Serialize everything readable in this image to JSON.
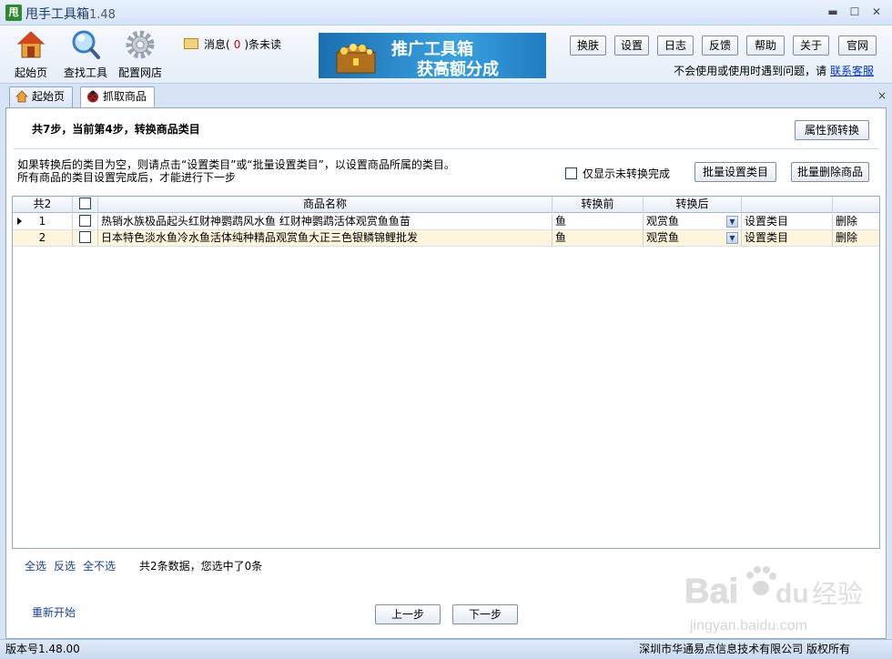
{
  "window": {
    "logo_char": "甩",
    "title": "甩手工具箱",
    "version": "1.48",
    "minimize": "▬",
    "maximize": "☐",
    "close": "✕"
  },
  "toolbar": {
    "tools": [
      {
        "label": "起始页",
        "icon": "home-icon"
      },
      {
        "label": "查找工具",
        "icon": "magnifier-icon"
      },
      {
        "label": "配置网店",
        "icon": "gear-icon"
      }
    ],
    "messages": {
      "prefix": "消息(",
      "count": "0",
      "suffix": ")条未读",
      "icon": "envelope-icon"
    },
    "banner": {
      "line1": "推广工具箱",
      "line2": "获高额分成",
      "icon": "treasure-chest-icon"
    },
    "buttons": [
      "换肤",
      "设置",
      "日志",
      "反馈",
      "帮助",
      "关于",
      "官网"
    ],
    "help_text": "不会使用或使用时遇到问题，请",
    "help_link": "联系客服"
  },
  "tabs": [
    {
      "label": "起始页",
      "icon": "home-icon",
      "active": false
    },
    {
      "label": "抓取商品",
      "icon": "ladybug-icon",
      "active": true
    }
  ],
  "tab_close": "×",
  "step": {
    "title": "共7步，当前第4步，转换商品类目",
    "preview_button": "属性预转换",
    "note1": "如果转换后的类目为空，则请点击“设置类目”或“批量设置类目”，以设置商品所属的类目。",
    "note2": "所有商品的类目设置完成后，才能进行下一步",
    "only_unconverted": "仅显示未转换完成",
    "batch_set_button": "批量设置类目",
    "batch_delete_button": "批量删除商品"
  },
  "grid": {
    "headers": {
      "count": "共2",
      "name": "商品名称",
      "before": "转换前",
      "after": "转换后"
    },
    "rows": [
      {
        "no": "1",
        "name": "热销水族极品起头红财神鹦鹉风水鱼 红财神鹦鹉活体观赏鱼鱼苗",
        "before": "鱼",
        "after": "观赏鱼",
        "set": "设置类目",
        "del": "删除"
      },
      {
        "no": "2",
        "name": "日本特色淡水鱼冷水鱼活体纯种精品观赏鱼大正三色银鳞锦鲤批发",
        "before": "鱼",
        "after": "观赏鱼",
        "set": "设置类目",
        "del": "删除"
      }
    ]
  },
  "bottom": {
    "select_all": "全选",
    "invert": "反选",
    "select_none": "全不选",
    "summary": "共2条数据，您选中了0条",
    "restart": "重新开始",
    "prev": "上一步",
    "next": "下一步"
  },
  "status": {
    "version": "版本号1.48.00",
    "copyright": "深圳市华通易点信息技术有限公司 版权所有"
  },
  "watermark": {
    "brand": "Bai",
    "brand2": "du",
    "cn": "经验",
    "url": "jingyan.baidu.com"
  }
}
